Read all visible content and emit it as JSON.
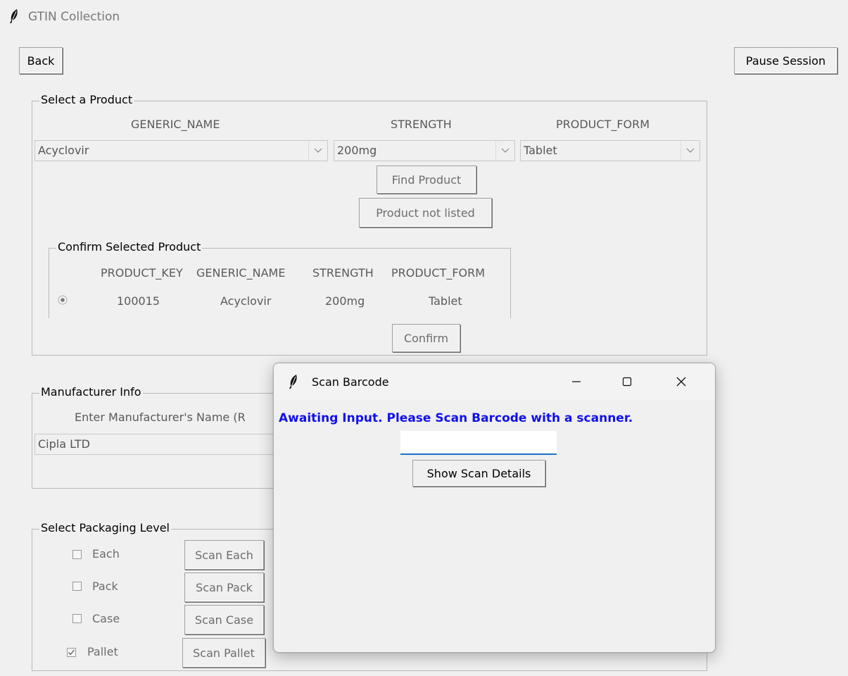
{
  "window": {
    "title": "GTIN Collection"
  },
  "toolbar": {
    "back_label": "Back",
    "pause_label": "Pause Session"
  },
  "select_product": {
    "group_label": "Select a Product",
    "headers": {
      "generic_name": "GENERIC_NAME",
      "strength": "STRENGTH",
      "product_form": "PRODUCT_FORM"
    },
    "values": {
      "generic_name": "Acyclovir",
      "strength": "200mg",
      "product_form": "Tablet"
    },
    "find_label": "Find Product",
    "not_listed_label": "Product not listed"
  },
  "confirm_product": {
    "group_label": "Confirm Selected Product",
    "columns": [
      "PRODUCT_KEY",
      "GENERIC_NAME",
      "STRENGTH",
      "PRODUCT_FORM"
    ],
    "row": {
      "product_key": "100015",
      "generic_name": "Acyclovir",
      "strength": "200mg",
      "product_form": "Tablet"
    },
    "confirm_label": "Confirm"
  },
  "manufacturer": {
    "group_label": "Manufacturer Info",
    "prompt": "Enter Manufacturer's Name (R",
    "value": "Cipla LTD"
  },
  "packaging": {
    "group_label": "Select Packaging Level",
    "levels": [
      {
        "label": "Each",
        "checked": false,
        "button": "Scan Each"
      },
      {
        "label": "Pack",
        "checked": false,
        "button": "Scan Pack"
      },
      {
        "label": "Case",
        "checked": false,
        "button": "Scan Case"
      },
      {
        "label": "Pallet",
        "checked": true,
        "button": "Scan Pallet"
      }
    ]
  },
  "scan_dialog": {
    "title": "Scan Barcode",
    "message": "Awaiting Input. Please Scan Barcode with a scanner.",
    "input_value": "",
    "details_label": "Show Scan Details"
  },
  "colors": {
    "message_blue": "#1010ee",
    "input_underline": "#1a6fc8"
  }
}
